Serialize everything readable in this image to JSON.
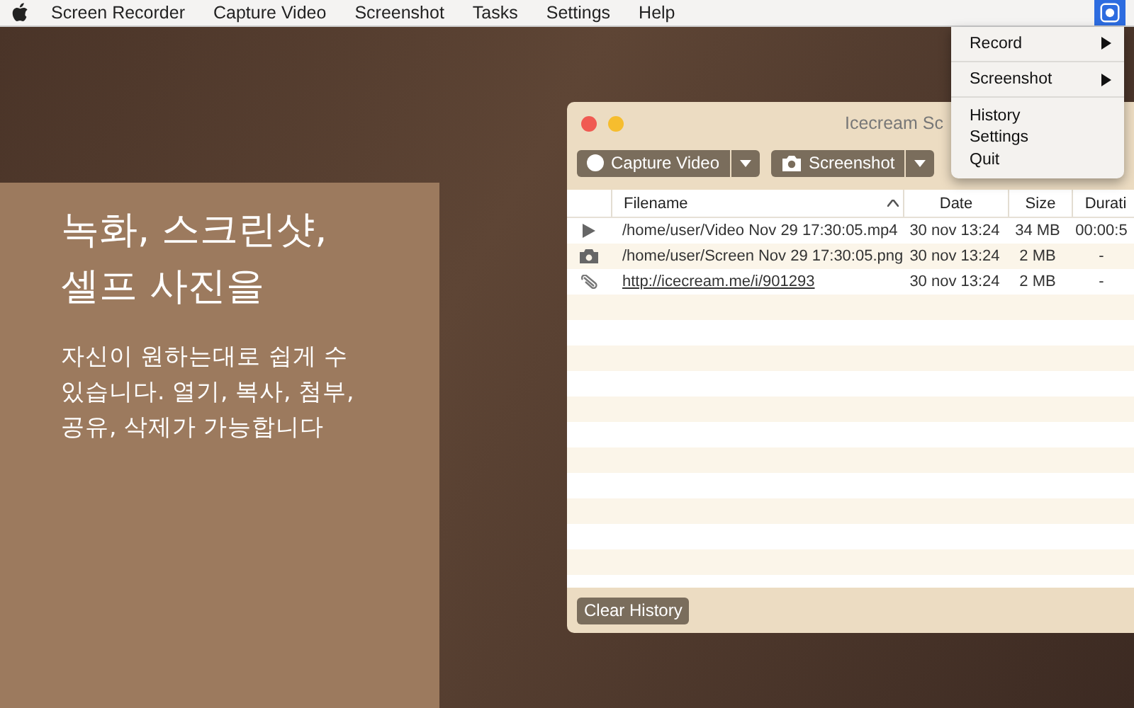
{
  "menu_bar": {
    "items": [
      "Screen Recorder",
      "Capture Video",
      "Screenshot",
      "Tasks",
      "Settings",
      "Help"
    ],
    "status_icon": {
      "selected": true
    }
  },
  "promo": {
    "headline": "녹화, 스크린샷,\n셀프 사진을",
    "body": "자신이 원하는대로 쉽게 수\n있습니다. 열기, 복사, 첨부,\n공유, 삭제가 가능합니다"
  },
  "window": {
    "title": "Icecream Sc",
    "toolbar": [
      {
        "label": "Capture Video",
        "kind": "record"
      },
      {
        "label": "Screenshot",
        "kind": "camera"
      }
    ],
    "table": {
      "columns": [
        "Filename",
        "Date",
        "Size",
        "Durati"
      ],
      "rows": [
        {
          "kind": "video",
          "filename": "/home/user/Video Nov 29 17:30:05.mp4",
          "date": "30 nov 13:24",
          "size": "34 MB",
          "duration": "00:00:5"
        },
        {
          "kind": "image",
          "filename": "/home/user/Screen Nov 29 17:30:05.png",
          "date": "30 nov 13:24",
          "size": "2 MB",
          "duration": "-"
        },
        {
          "kind": "link",
          "filename": "http://icecream.me/i/901293",
          "date": "30 nov 13:24",
          "size": "2 MB",
          "duration": "-"
        }
      ]
    },
    "clear_button": "Clear History"
  },
  "dropdown_menu": [
    {
      "label": "Record",
      "kind": "submenu"
    },
    {
      "label": "Screenshot",
      "kind": "submenu"
    },
    {
      "label": "History",
      "kind": "item"
    },
    {
      "label": "Settings",
      "kind": "item"
    },
    {
      "label": "Quit",
      "kind": "item"
    }
  ]
}
